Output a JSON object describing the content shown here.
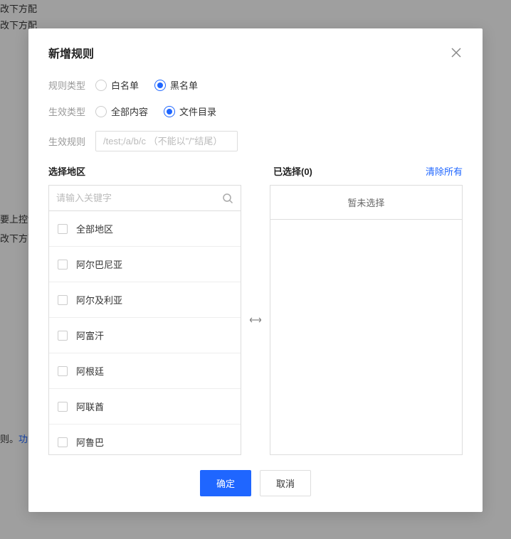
{
  "background": {
    "text1": "改下方配",
    "text2": "改下方配",
    "text3": "要上控制",
    "text4": "改下方配",
    "text5_prefix": "则。",
    "text5_link": "功能"
  },
  "modal": {
    "title": "新增规则",
    "form": {
      "ruleType": {
        "label": "规则类型",
        "options": [
          {
            "label": "白名单",
            "checked": false
          },
          {
            "label": "黑名单",
            "checked": true
          }
        ]
      },
      "effectType": {
        "label": "生效类型",
        "options": [
          {
            "label": "全部内容",
            "checked": false
          },
          {
            "label": "文件目录",
            "checked": true
          }
        ]
      },
      "effectRule": {
        "label": "生效规则",
        "placeholder": "/test;/a/b/c （不能以\"/\"结尾）"
      }
    },
    "transfer": {
      "leftTitle": "选择地区",
      "rightTitle": "已选择(0)",
      "clearAll": "清除所有",
      "searchPlaceholder": "请输入关键字",
      "emptyText": "暂未选择",
      "regions": [
        "全部地区",
        "阿尔巴尼亚",
        "阿尔及利亚",
        "阿富汗",
        "阿根廷",
        "阿联酋",
        "阿鲁巴"
      ]
    },
    "footer": {
      "confirm": "确定",
      "cancel": "取消"
    }
  }
}
